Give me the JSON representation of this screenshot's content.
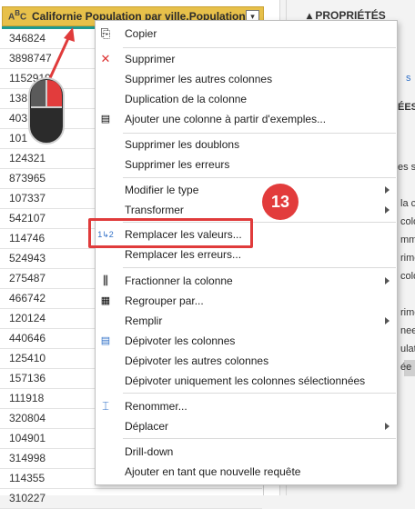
{
  "column": {
    "type_icon": "ABC",
    "title": "Californie Population par ville.Population",
    "dropdown": "▾"
  },
  "rows": [
    "346824",
    "3898747",
    "1152919",
    "138",
    "403",
    "101",
    "124321",
    "873965",
    "107337",
    "542107",
    "114746",
    "524943",
    "275487",
    "466742",
    "120124",
    "440646",
    "125410",
    "157136",
    "111918",
    "320804",
    "104901",
    "314998",
    "114355",
    "310227"
  ],
  "panel": {
    "title": "PROPRIÉTÉS",
    "fragments": [
      "s",
      "ÉES",
      "es su",
      "la c",
      "colo",
      "mme",
      "rime",
      "colo",
      "rime",
      "nee",
      "ulati",
      "ée"
    ]
  },
  "annotation": {
    "badge": "13"
  },
  "menu": {
    "items": [
      {
        "label": "Copier",
        "icon": "copy-icon"
      },
      {
        "label": "Supprimer",
        "icon": "delete-icon"
      },
      {
        "label": "Supprimer les autres colonnes",
        "icon": ""
      },
      {
        "label": "Duplication de la colonne",
        "icon": ""
      },
      {
        "label": "Ajouter une colonne à partir d'exemples...",
        "icon": "add-column-icon"
      },
      {
        "label": "Supprimer les doublons",
        "icon": ""
      },
      {
        "label": "Supprimer les erreurs",
        "icon": ""
      },
      {
        "label": "Modifier le type",
        "icon": ""
      },
      {
        "label": "Transformer",
        "icon": ""
      },
      {
        "label": "Remplacer les valeurs...",
        "icon": "replace-values-icon"
      },
      {
        "label": "Remplacer les erreurs...",
        "icon": ""
      },
      {
        "label": "Fractionner la colonne",
        "icon": "split-column-icon"
      },
      {
        "label": "Regrouper par...",
        "icon": "group-by-icon"
      },
      {
        "label": "Remplir",
        "icon": ""
      },
      {
        "label": "Dépivoter les colonnes",
        "icon": "unpivot-icon"
      },
      {
        "label": "Dépivoter les autres colonnes",
        "icon": ""
      },
      {
        "label": "Dépivoter uniquement les colonnes sélectionnées",
        "icon": ""
      },
      {
        "label": "Renommer...",
        "icon": "rename-icon"
      },
      {
        "label": "Déplacer",
        "icon": ""
      },
      {
        "label": "Drill-down",
        "icon": ""
      },
      {
        "label": "Ajouter en tant que nouvelle requête",
        "icon": ""
      }
    ]
  },
  "colors": {
    "header": "#e7c04a",
    "accent_line": "#1f9a91",
    "highlight": "#e03b3b",
    "link": "#2f6fc7"
  }
}
